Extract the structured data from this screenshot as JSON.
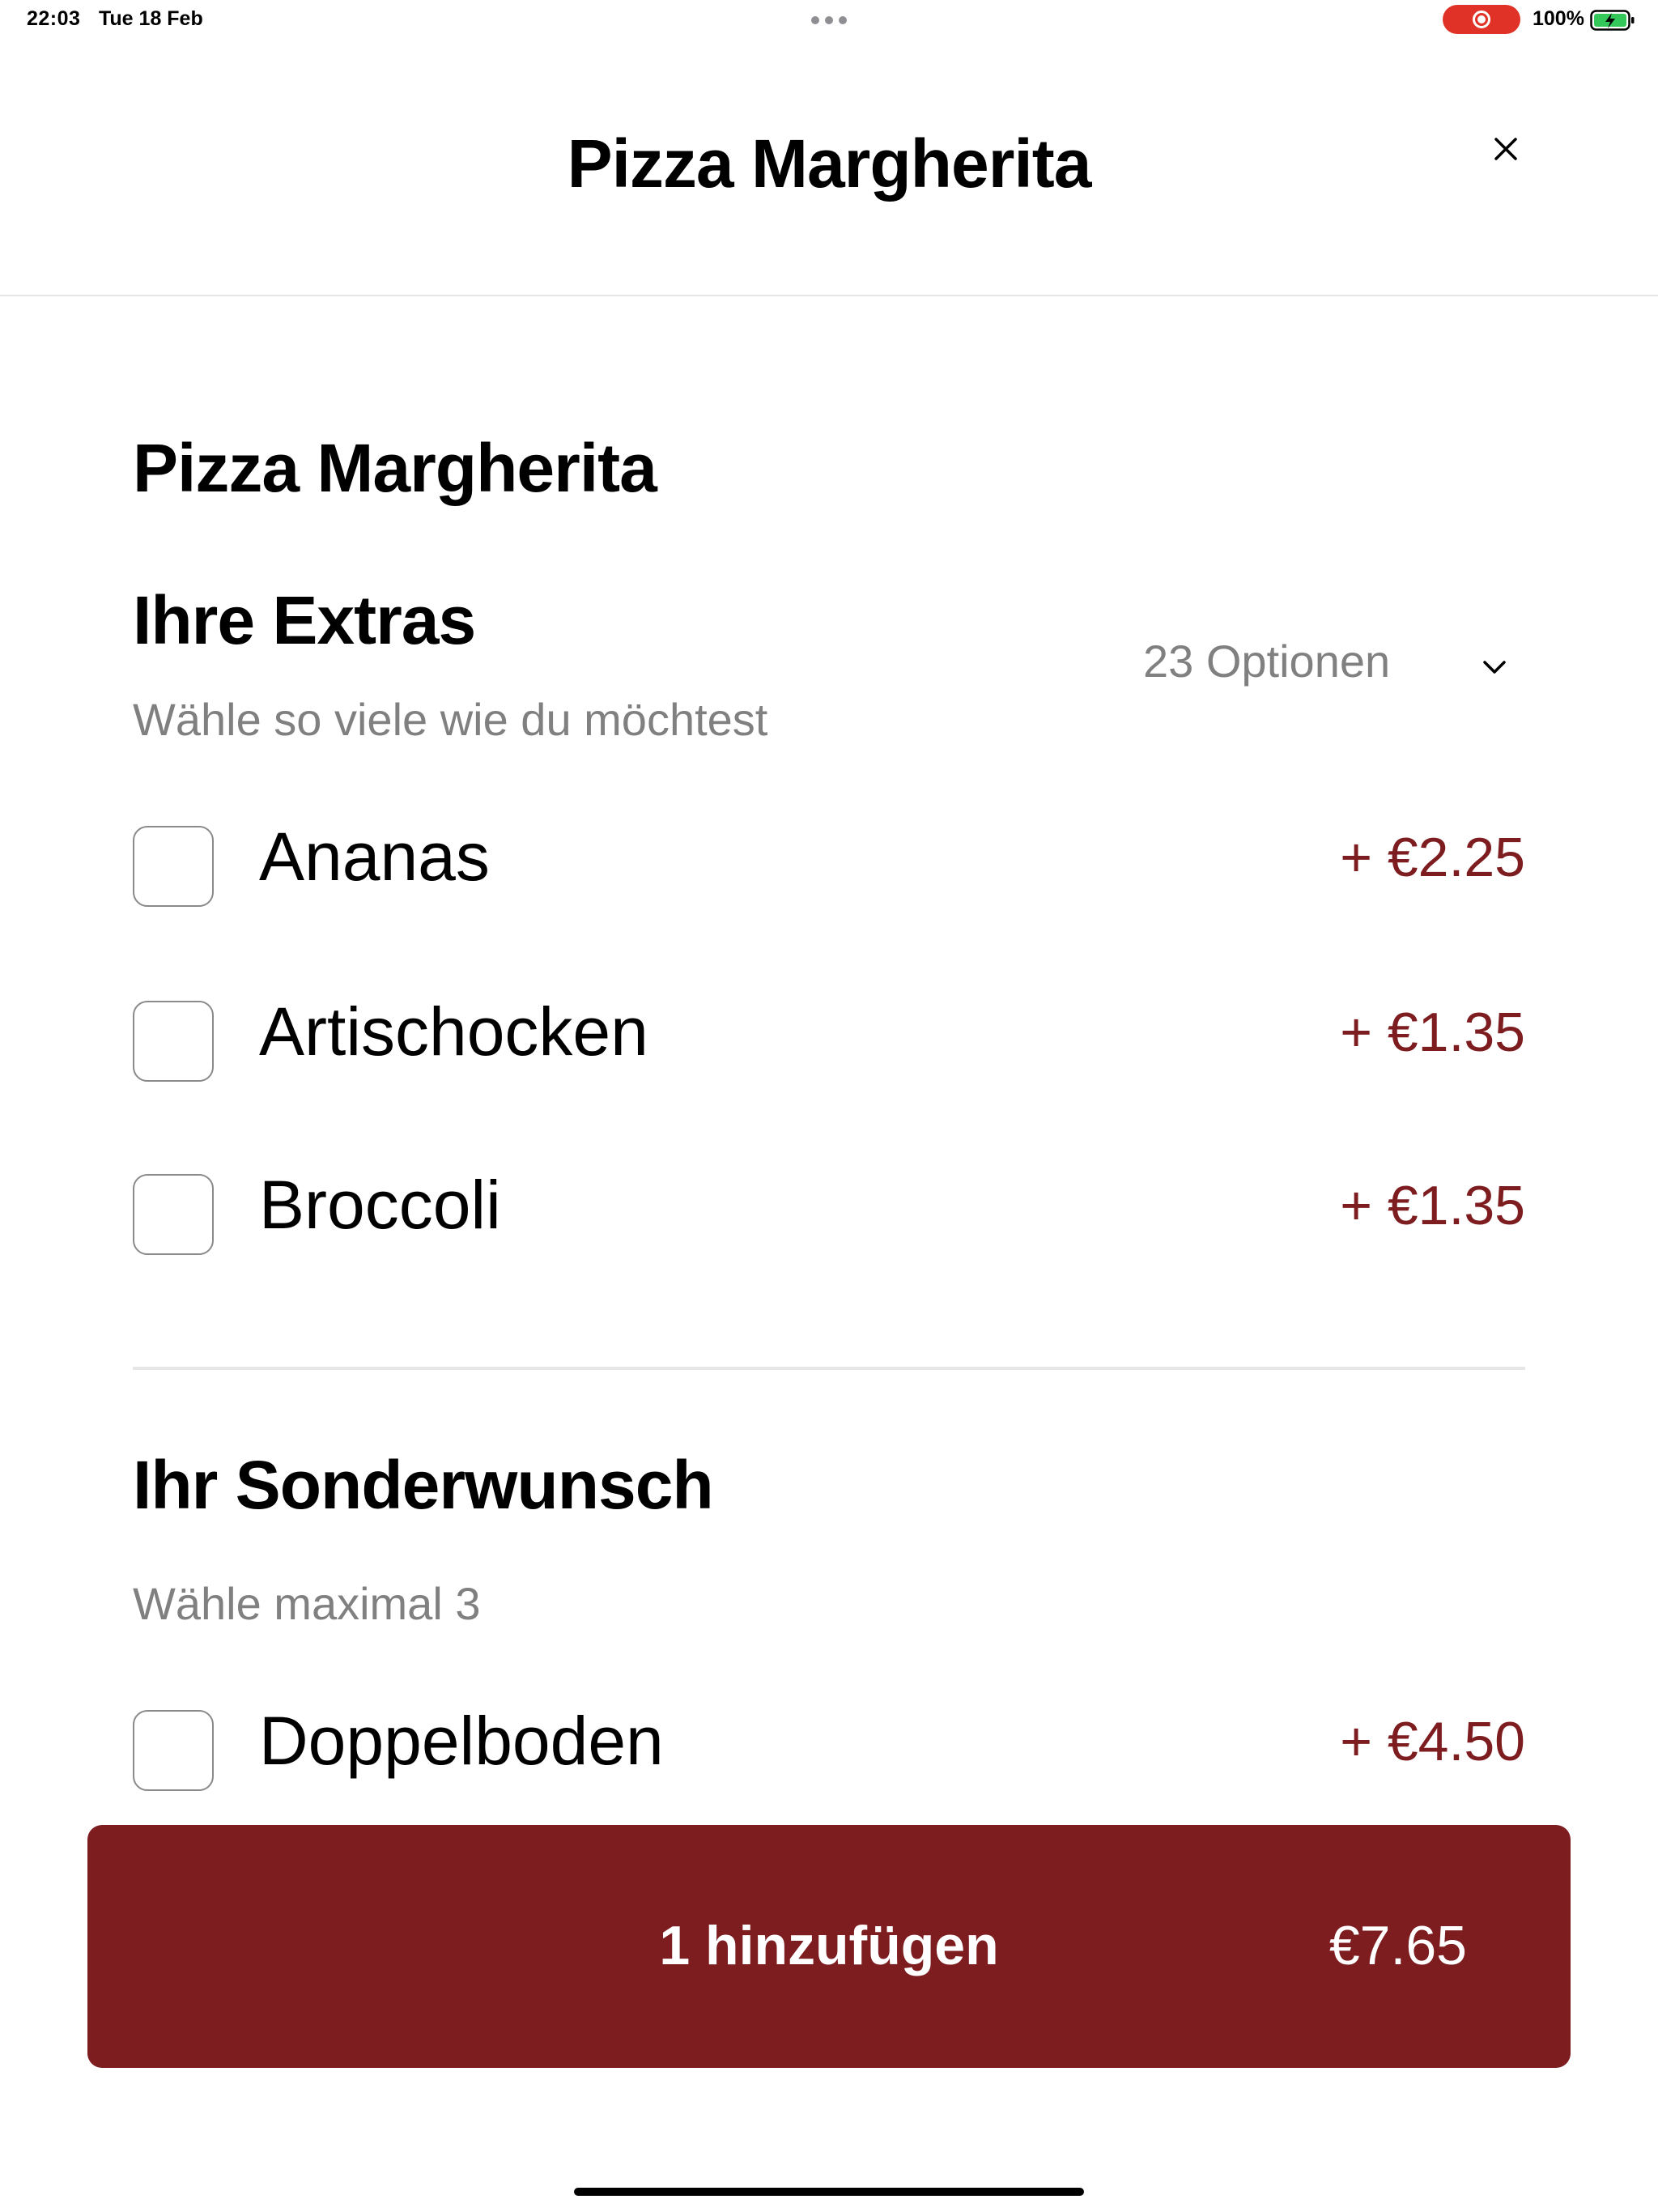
{
  "status_bar": {
    "time": "22:03",
    "date": "Tue 18 Feb",
    "battery_percent": "100%",
    "recording_color": "#e03226",
    "battery_fill_color": "#34c759"
  },
  "header": {
    "title": "Pizza Margherita",
    "close_icon": "close-icon"
  },
  "item_name": "Pizza Margherita",
  "extras": {
    "title": "Ihre Extras",
    "subtitle": "Wähle so viele wie du möchtest",
    "options_count": "23 Optionen",
    "options": [
      {
        "label": "Ananas",
        "price": "+ €2.25",
        "checked": false
      },
      {
        "label": "Artischocken",
        "price": "+ €1.35",
        "checked": false
      },
      {
        "label": "Broccoli",
        "price": "+ €1.35",
        "checked": false
      }
    ]
  },
  "special_request": {
    "title": "Ihr Sonderwunsch",
    "subtitle": "Wähle maximal 3",
    "options": [
      {
        "label": "Doppelboden",
        "price": "+ €4.50",
        "checked": false
      }
    ]
  },
  "add_button": {
    "label": "1 hinzufügen",
    "price": "€7.65",
    "color": "#7d1d20"
  }
}
